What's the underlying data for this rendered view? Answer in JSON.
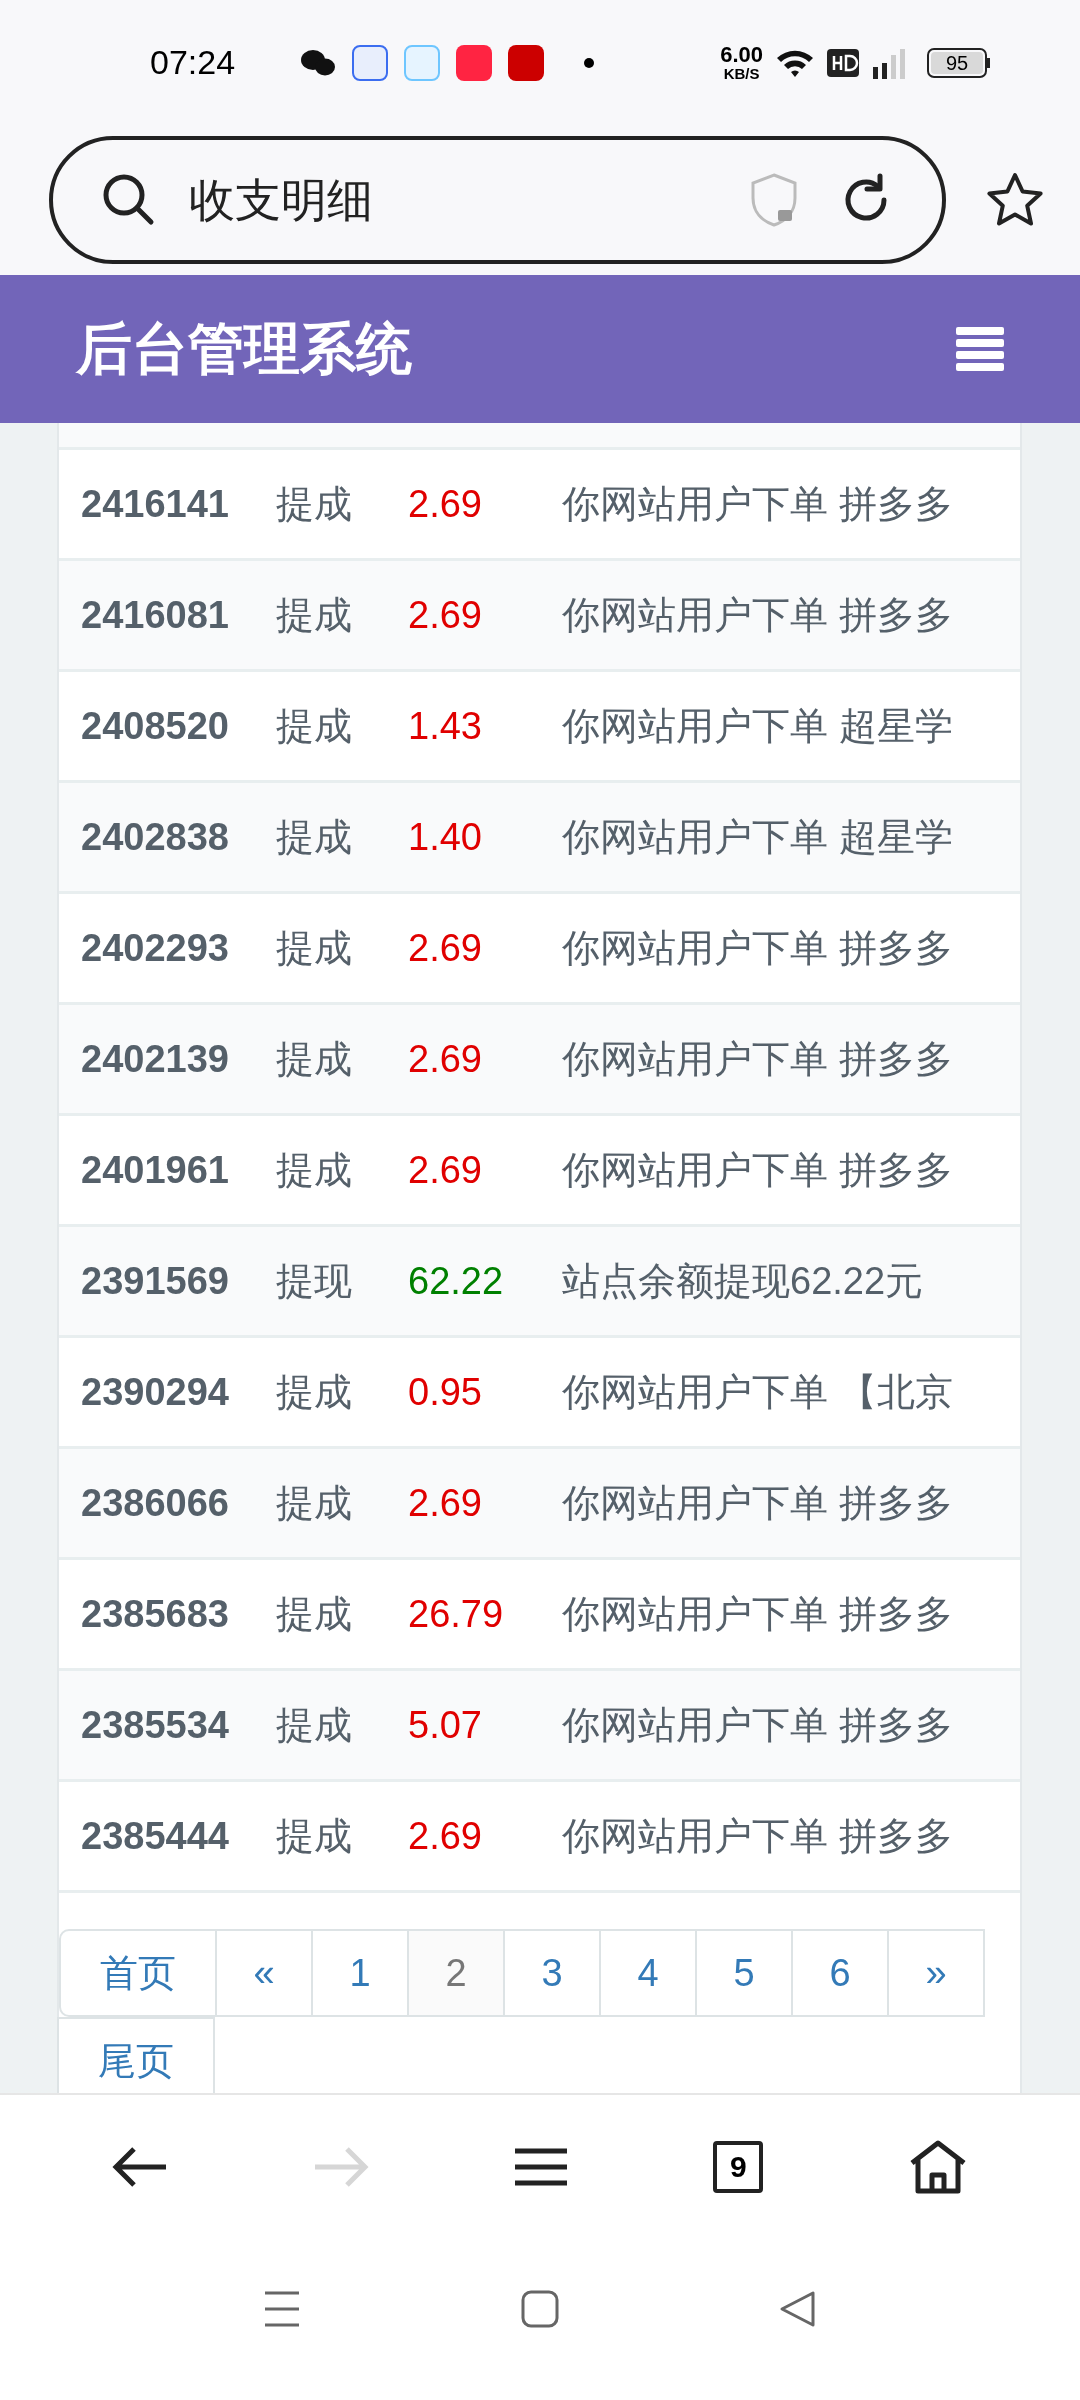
{
  "status_bar": {
    "time": "07:24",
    "net_speed": "6.00",
    "net_unit": "KB/S",
    "battery": "95"
  },
  "search": {
    "value": "收支明细"
  },
  "header": {
    "title": "后台管理系统"
  },
  "table": {
    "rows": [
      {
        "id": "2416141",
        "type": "提成",
        "amount": "2.69",
        "kind": "commission",
        "desc": "你网站用户下单 拼多多"
      },
      {
        "id": "2416081",
        "type": "提成",
        "amount": "2.69",
        "kind": "commission",
        "desc": "你网站用户下单 拼多多"
      },
      {
        "id": "2408520",
        "type": "提成",
        "amount": "1.43",
        "kind": "commission",
        "desc": "你网站用户下单 超星学"
      },
      {
        "id": "2402838",
        "type": "提成",
        "amount": "1.40",
        "kind": "commission",
        "desc": "你网站用户下单 超星学"
      },
      {
        "id": "2402293",
        "type": "提成",
        "amount": "2.69",
        "kind": "commission",
        "desc": "你网站用户下单 拼多多"
      },
      {
        "id": "2402139",
        "type": "提成",
        "amount": "2.69",
        "kind": "commission",
        "desc": "你网站用户下单 拼多多"
      },
      {
        "id": "2401961",
        "type": "提成",
        "amount": "2.69",
        "kind": "commission",
        "desc": "你网站用户下单 拼多多"
      },
      {
        "id": "2391569",
        "type": "提现",
        "amount": "62.22",
        "kind": "withdrawal",
        "desc": "站点余额提现62.22元"
      },
      {
        "id": "2390294",
        "type": "提成",
        "amount": "0.95",
        "kind": "commission",
        "desc": "你网站用户下单 【北京"
      },
      {
        "id": "2386066",
        "type": "提成",
        "amount": "2.69",
        "kind": "commission",
        "desc": "你网站用户下单 拼多多"
      },
      {
        "id": "2385683",
        "type": "提成",
        "amount": "26.79",
        "kind": "commission",
        "desc": "你网站用户下单 拼多多"
      },
      {
        "id": "2385534",
        "type": "提成",
        "amount": "5.07",
        "kind": "commission",
        "desc": "你网站用户下单 拼多多"
      },
      {
        "id": "2385444",
        "type": "提成",
        "amount": "2.69",
        "kind": "commission",
        "desc": "你网站用户下单 拼多多"
      }
    ]
  },
  "pagination": [
    {
      "label": "首页",
      "kind": "wide",
      "selected": false
    },
    {
      "label": "«",
      "kind": "narrow",
      "selected": false
    },
    {
      "label": "1",
      "kind": "narrow",
      "selected": false
    },
    {
      "label": "2",
      "kind": "narrow",
      "selected": true
    },
    {
      "label": "3",
      "kind": "narrow",
      "selected": false
    },
    {
      "label": "4",
      "kind": "narrow",
      "selected": false
    },
    {
      "label": "5",
      "kind": "narrow",
      "selected": false
    },
    {
      "label": "6",
      "kind": "narrow",
      "selected": false
    },
    {
      "label": "»",
      "kind": "narrow",
      "selected": false
    },
    {
      "label": "尾页",
      "kind": "wide",
      "selected": false
    }
  ],
  "browser_nav": {
    "tab_count": "9",
    "forward_disabled": true
  }
}
